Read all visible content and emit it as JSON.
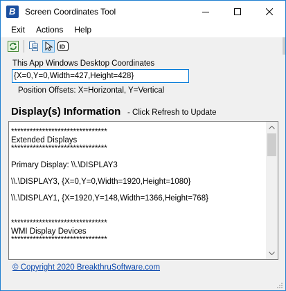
{
  "window": {
    "title": "Screen Coordinates Tool"
  },
  "menu": {
    "items": [
      {
        "label": "Exit"
      },
      {
        "label": "Actions"
      },
      {
        "label": "Help"
      }
    ]
  },
  "toolbar": {
    "icons": [
      "refresh-icon",
      "copy-icon",
      "pointer-icon",
      "id-icon"
    ]
  },
  "coords": {
    "label": "This App Windows Desktop Coordinates",
    "value": "{X=0,Y=0,Width=427,Height=428}",
    "offsets_label": "Position Offsets: X=Horizontal, Y=Vertical"
  },
  "display": {
    "heading": "Display(s) Information",
    "hint": "- Click Refresh to Update",
    "lines": [
      "*******************************",
      "Extended Displays",
      "*******************************",
      "",
      "Primary Display: \\\\.\\DISPLAY3",
      "",
      "\\\\.\\DISPLAY3, {X=0,Y=0,Width=1920,Height=1080}",
      "",
      "\\\\.\\DISPLAY1, {X=1920,Y=148,Width=1366,Height=768}",
      "",
      "",
      "*******************************",
      "WMI Display Devices",
      "*******************************"
    ]
  },
  "footer": {
    "copyright": "© Copyright 2020 BreakthruSoftware.com"
  },
  "colors": {
    "accent": "#0078d7",
    "link": "#0645ad",
    "border": "#1e7fd0"
  }
}
